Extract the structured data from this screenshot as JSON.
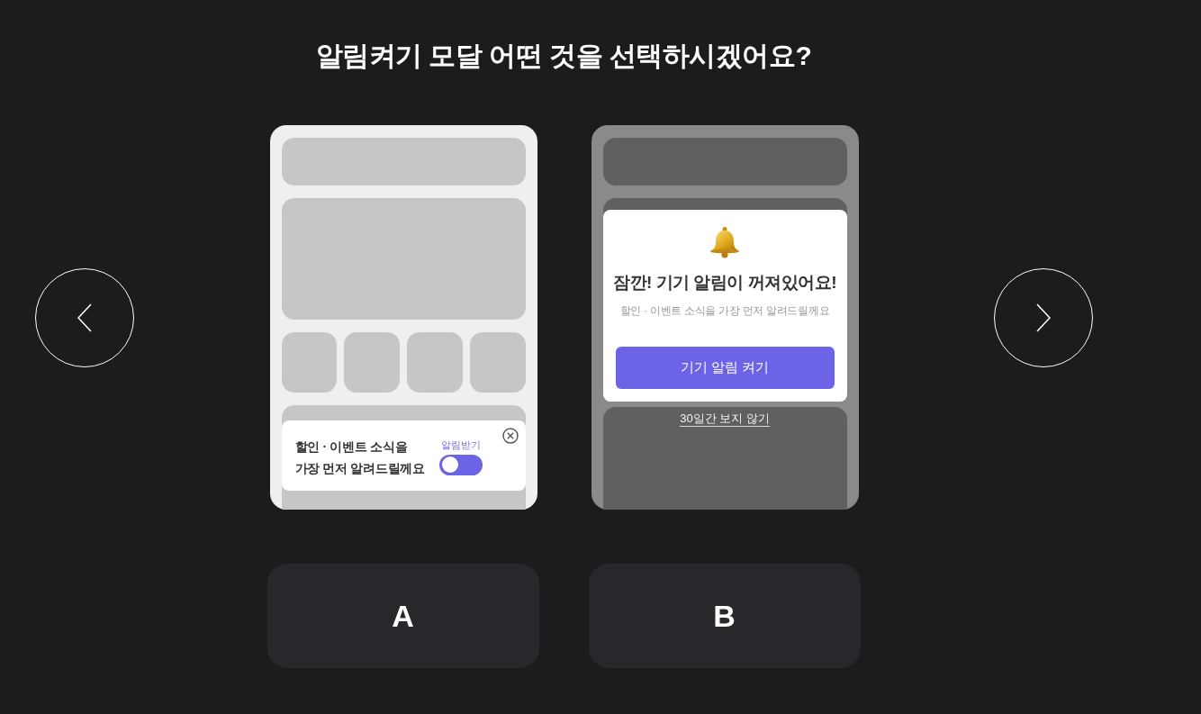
{
  "title": "알림켜기 모달 어떤 것을 선택하시겠어요?",
  "options": [
    {
      "kind": "toast",
      "toast": {
        "message_lines": [
          "할인 · 이벤트 소식을",
          "가장 먼저 알려드릴께요"
        ],
        "toggle_label": "알림받기",
        "toggle_on": false
      }
    },
    {
      "kind": "modal",
      "modal": {
        "title": "잠깐! 기기 알림이 꺼져있어요!",
        "message": "할인 · 이벤트 소식을 가장 먼저 알려드릴께요",
        "button": "기기 알림 켜기",
        "dismiss_link": "30일간 보지 않기"
      }
    }
  ],
  "choices": [
    {
      "label": "A"
    },
    {
      "label": "B"
    }
  ]
}
